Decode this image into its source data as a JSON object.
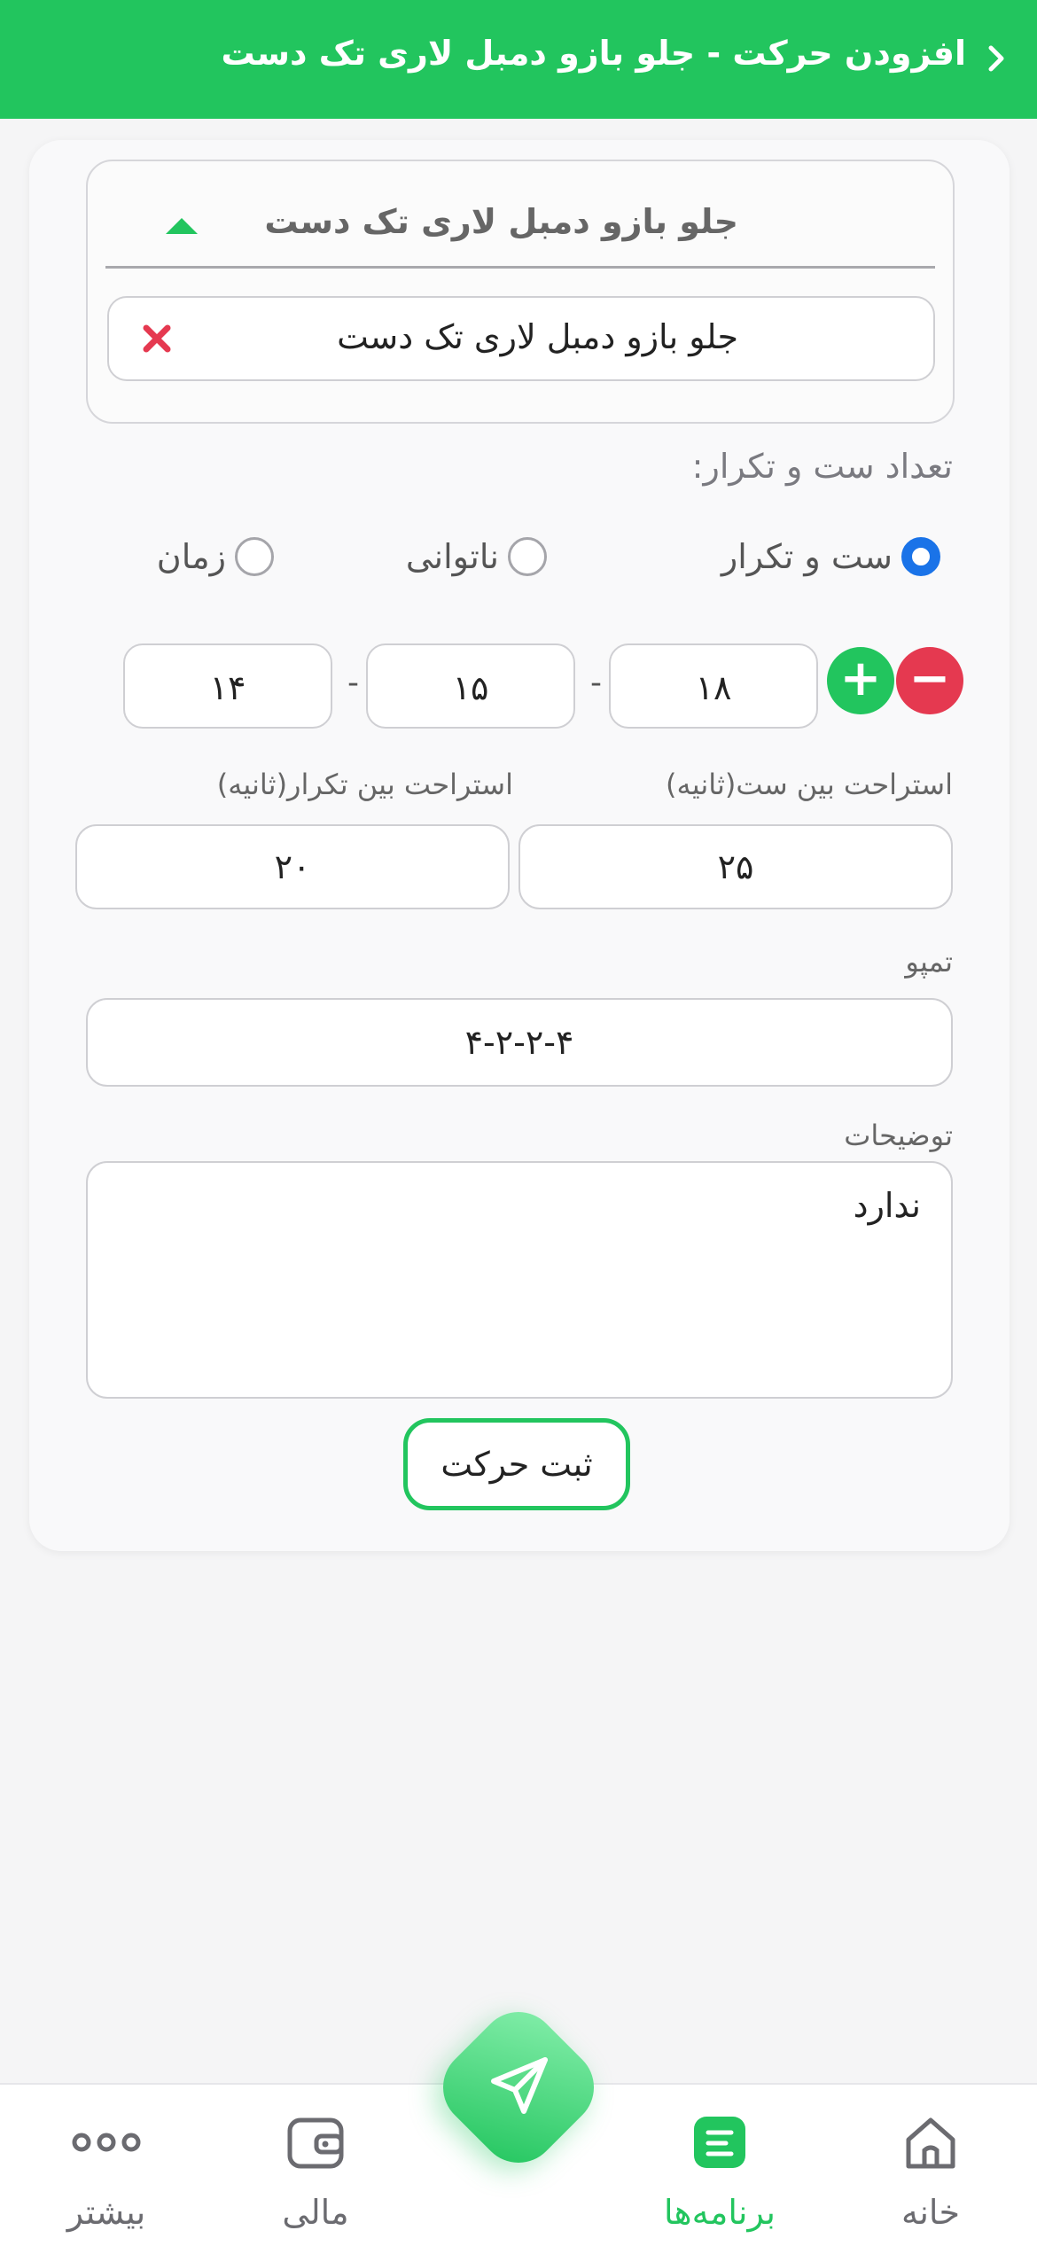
{
  "header": {
    "title": "افزودن حرکت - جلو بازو دمبل لاری تک دست"
  },
  "exercise_select": {
    "selected_label": "جلو بازو دمبل لاری تک دست",
    "chip_label": "جلو بازو دمبل لاری تک دست"
  },
  "sets_section": {
    "label": "تعداد ست و تکرار:",
    "radio_options": [
      "ست و تکرار",
      "ناتوانی",
      "زمان"
    ],
    "selected_option": "ست و تکرار",
    "reps": [
      "۱۸",
      "۱۵",
      "۱۴"
    ],
    "dash": "-",
    "plus": "+",
    "minus": "−"
  },
  "rest": {
    "between_sets_label": "استراحت بین ست(ثانیه)",
    "between_sets_value": "۲۵",
    "between_reps_label": "استراحت بین تکرار(ثانیه)",
    "between_reps_value": "۲۰"
  },
  "tempo": {
    "label": "تمپو",
    "value": "۴-۲-۲-۴"
  },
  "notes": {
    "label": "توضیحات",
    "value": "ندارد"
  },
  "submit_label": "ثبت حرکت",
  "bottom_nav": {
    "items": [
      {
        "label": "خانه",
        "icon": "home-icon",
        "active": false
      },
      {
        "label": "برنامه‌ها",
        "icon": "programs-icon",
        "active": true
      },
      {
        "label": "مالی",
        "icon": "wallet-icon",
        "active": false
      },
      {
        "label": "بیشتر",
        "icon": "more-icon",
        "active": false
      }
    ],
    "fab_icon": "send-icon"
  },
  "colors": {
    "primary": "#22c55e",
    "radio_active": "#1a73e8",
    "danger": "#e53950"
  }
}
